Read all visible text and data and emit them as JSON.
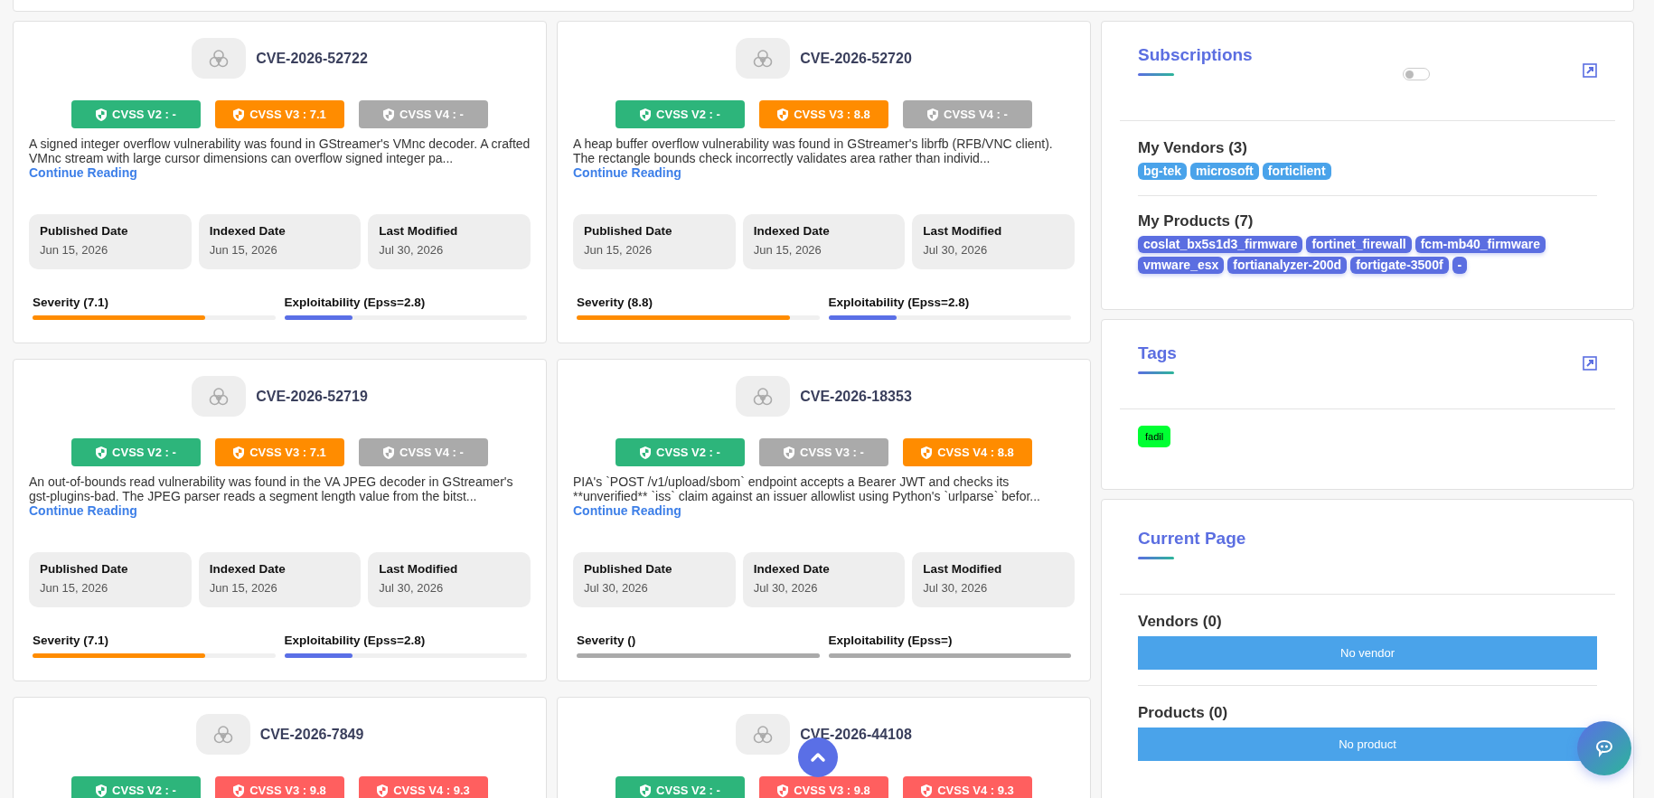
{
  "cards": [
    {
      "cve": "CVE-2026-52722",
      "badges": [
        {
          "label": "CVSS V2 : -",
          "color": "#2db57b"
        },
        {
          "label": "CVSS V3 : 7.1",
          "color": "#ff8c00"
        },
        {
          "label": "CVSS V4 : -",
          "color": "#aaaaaa"
        }
      ],
      "description": "A signed integer overflow vulnerability was found in GStreamer's VMnc decoder. A crafted VMnc stream with large cursor dimensions can overflow signed integer pa...",
      "link": "Continue Reading",
      "dates": [
        {
          "label": "Published Date",
          "value": "Jun 15, 2026"
        },
        {
          "label": "Indexed Date",
          "value": "Jun 15, 2026"
        },
        {
          "label": "Last Modified",
          "value": "Jul 30, 2026"
        }
      ],
      "meters": [
        {
          "label": "Severity (7.1)",
          "level": 0.71,
          "color": "#ff8c00"
        },
        {
          "label": "Exploitability (Epss=2.8)",
          "level": 0.28,
          "color": "#5a6fe6"
        }
      ]
    },
    {
      "cve": "CVE-2026-52720",
      "badges": [
        {
          "label": "CVSS V2 : -",
          "color": "#2db57b"
        },
        {
          "label": "CVSS V3 : 8.8",
          "color": "#ff8c00"
        },
        {
          "label": "CVSS V4 : -",
          "color": "#aaaaaa"
        }
      ],
      "description": "A heap buffer overflow vulnerability was found in GStreamer's librfb (RFB/VNC client). The rectangle bounds check incorrectly validates area rather than individ...",
      "link": "Continue Reading",
      "dates": [
        {
          "label": "Published Date",
          "value": "Jun 15, 2026"
        },
        {
          "label": "Indexed Date",
          "value": "Jun 15, 2026"
        },
        {
          "label": "Last Modified",
          "value": "Jul 30, 2026"
        }
      ],
      "meters": [
        {
          "label": "Severity (8.8)",
          "level": 0.88,
          "color": "#ff8c00"
        },
        {
          "label": "Exploitability (Epss=2.8)",
          "level": 0.28,
          "color": "#5a6fe6"
        }
      ]
    },
    {
      "cve": "CVE-2026-52719",
      "badges": [
        {
          "label": "CVSS V2 : -",
          "color": "#2db57b"
        },
        {
          "label": "CVSS V3 : 7.1",
          "color": "#ff8c00"
        },
        {
          "label": "CVSS V4 : -",
          "color": "#aaaaaa"
        }
      ],
      "description": "An out-of-bounds read vulnerability was found in the VA JPEG decoder in GStreamer's gst-plugins-bad. The JPEG parser reads a segment length value from the bitst...",
      "link": "Continue Reading",
      "dates": [
        {
          "label": "Published Date",
          "value": "Jun 15, 2026"
        },
        {
          "label": "Indexed Date",
          "value": "Jun 15, 2026"
        },
        {
          "label": "Last Modified",
          "value": "Jul 30, 2026"
        }
      ],
      "meters": [
        {
          "label": "Severity (7.1)",
          "level": 0.71,
          "color": "#ff8c00"
        },
        {
          "label": "Exploitability (Epss=2.8)",
          "level": 0.28,
          "color": "#5a6fe6"
        }
      ]
    },
    {
      "cve": "CVE-2026-18353",
      "badges": [
        {
          "label": "CVSS V2 : -",
          "color": "#2db57b"
        },
        {
          "label": "CVSS V3 : -",
          "color": "#aaaaaa"
        },
        {
          "label": "CVSS V4 : 8.8",
          "color": "#ff8c00"
        }
      ],
      "description": "PIA's `POST /v1/upload/sbom` endpoint accepts a Bearer JWT and checks its **unverified** `iss` claim against an issuer allowlist using Python's `urlparse` befor...",
      "link": "Continue Reading",
      "dates": [
        {
          "label": "Published Date",
          "value": "Jul 30, 2026"
        },
        {
          "label": "Indexed Date",
          "value": "Jul 30, 2026"
        },
        {
          "label": "Last Modified",
          "value": "Jul 30, 2026"
        }
      ],
      "meters": [
        {
          "label": "Severity ()",
          "level": 1,
          "color": "#aaaaaa"
        },
        {
          "label": "Exploitability (Epss=)",
          "level": 1,
          "color": "#aaaaaa"
        }
      ]
    },
    {
      "cve": "CVE-2026-7849",
      "badges": [
        {
          "label": "CVSS V2 : -",
          "color": "#2db57b"
        },
        {
          "label": "CVSS V3 : 9.8",
          "color": "#ff5f5f"
        },
        {
          "label": "CVSS V4 : 9.3",
          "color": "#ff5f5f"
        }
      ]
    },
    {
      "cve": "CVE-2026-44108",
      "badges": [
        {
          "label": "CVSS V2 : -",
          "color": "#2db57b"
        },
        {
          "label": "CVSS V3 : 9.8",
          "color": "#ff5f5f"
        },
        {
          "label": "CVSS V4 : 9.3",
          "color": "#ff5f5f"
        }
      ]
    }
  ],
  "subscriptions": {
    "title": "Subscriptions",
    "toggle": {
      "on": false
    },
    "vendors": {
      "heading": "My Vendors (3)",
      "chips": [
        "bg-tek",
        "microsoft",
        "forticlient"
      ]
    },
    "products": {
      "heading": "My Products (7)",
      "chips": [
        "coslat_bx5s1d3_firmware",
        "fortinet_firewall",
        "fcm-mb40_firmware",
        "vmware_esx",
        "fortianalyzer-200d",
        "fortigate-3500f",
        "-"
      ]
    }
  },
  "tags": {
    "title": "Tags",
    "items": [
      {
        "label": "fadil",
        "color": "#00ff33"
      }
    ]
  },
  "current_page": {
    "title": "Current Page",
    "sections": [
      {
        "heading": "Vendors (0)",
        "empty": "No vendor"
      },
      {
        "heading": "Products (0)",
        "empty": "No product"
      }
    ]
  }
}
